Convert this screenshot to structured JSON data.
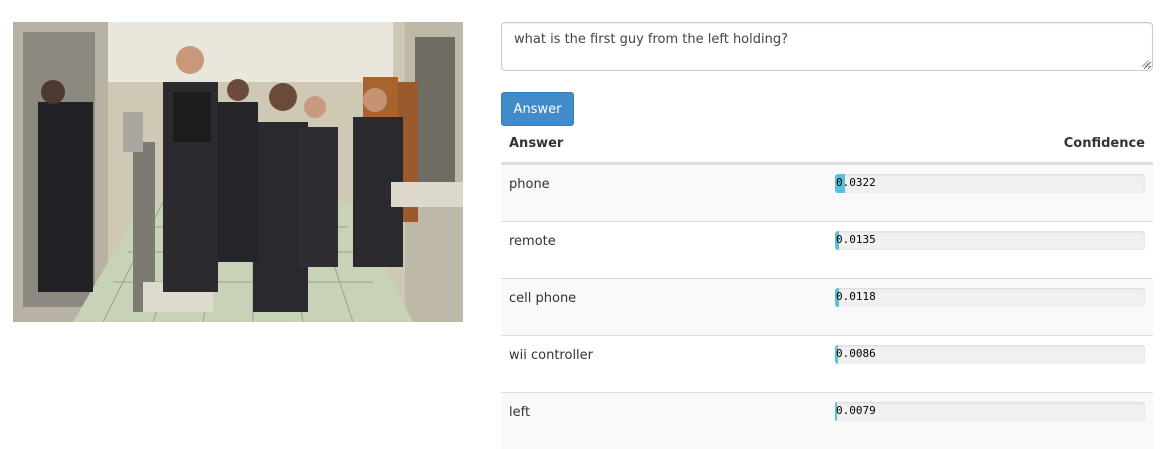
{
  "question": {
    "value": "what is the first guy from the left holding?"
  },
  "answer_button": {
    "label": "Answer"
  },
  "results": {
    "header_answer": "Answer",
    "header_confidence": "Confidence",
    "rows": [
      {
        "label": "phone",
        "confidence": "0.0322",
        "value": 0.0322
      },
      {
        "label": "remote",
        "confidence": "0.0135",
        "value": 0.0135
      },
      {
        "label": "cell phone",
        "confidence": "0.0118",
        "value": 0.0118
      },
      {
        "label": "wii controller",
        "confidence": "0.0086",
        "value": 0.0086
      },
      {
        "label": "left",
        "confidence": "0.0079",
        "value": 0.0079
      }
    ]
  },
  "colors": {
    "button": "#428bca",
    "bar_fill": "#5bc0de",
    "bar_track": "#f0f0f0"
  }
}
